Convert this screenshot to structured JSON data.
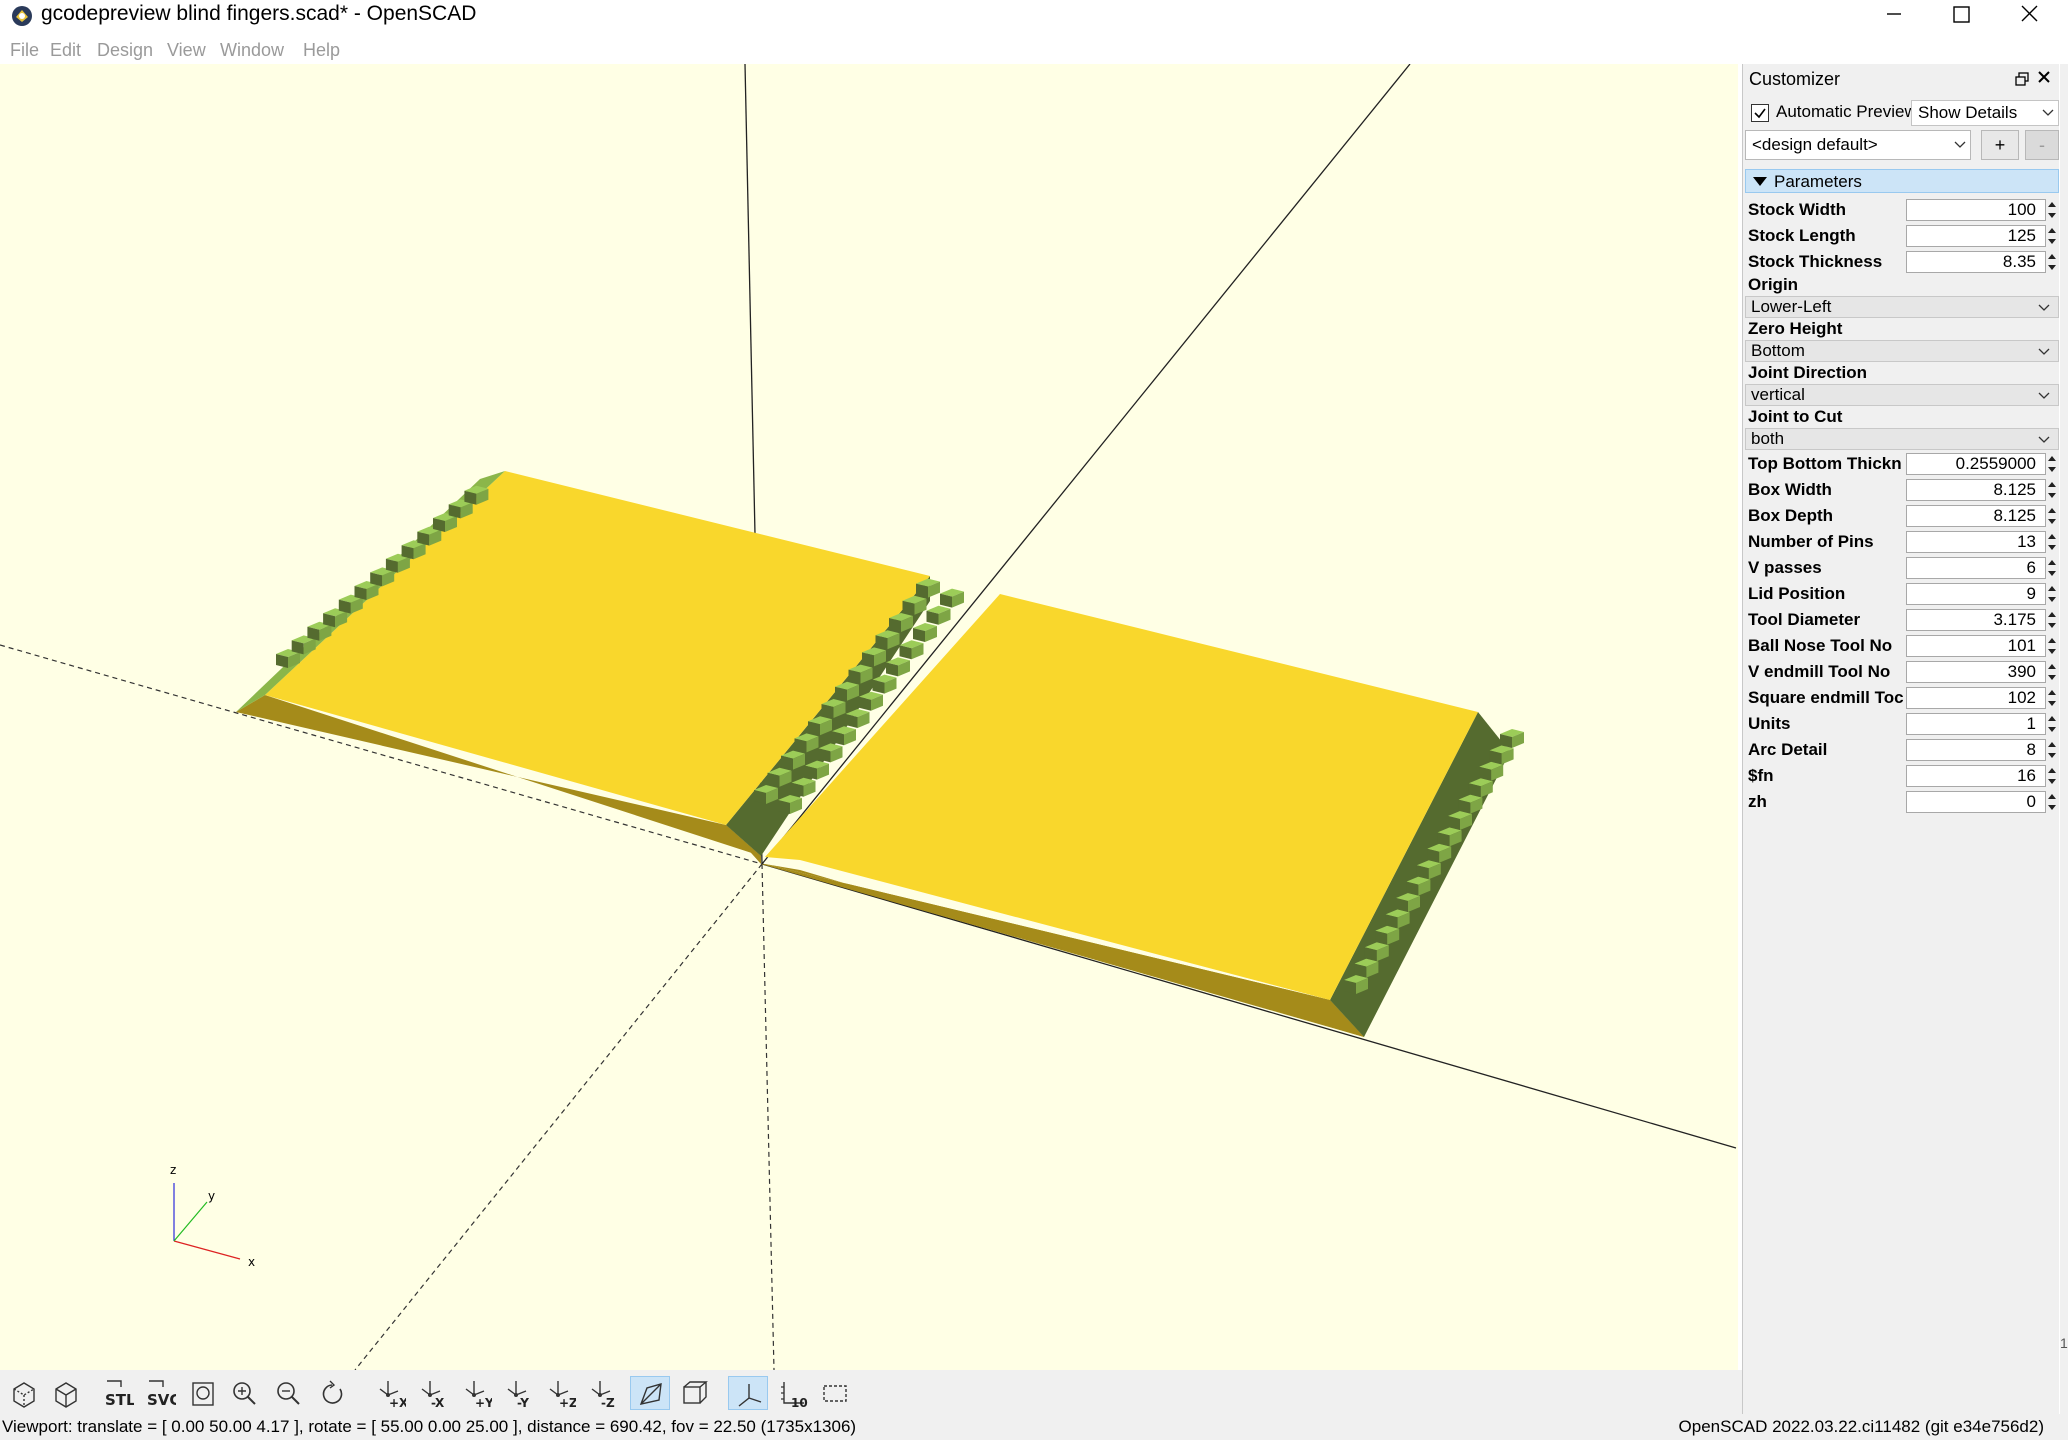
{
  "window": {
    "title": "gcodepreview blind fingers.scad* - OpenSCAD"
  },
  "menu": {
    "items": [
      "File",
      "Edit",
      "Design",
      "View",
      "Window",
      "Help"
    ]
  },
  "customizer": {
    "title": "Customizer",
    "auto_preview_label": "Automatic Preview",
    "auto_preview_checked": true,
    "show_details": "Show Details",
    "preset": "<design default>",
    "add_label": "+",
    "remove_label": "-",
    "section_label": "Parameters",
    "params": [
      {
        "label": "Stock Width",
        "value": "100"
      },
      {
        "label": "Stock Length",
        "value": "125"
      },
      {
        "label": "Stock Thickness",
        "value": "8.35"
      },
      {
        "label": "Origin",
        "select": "Lower-Left"
      },
      {
        "label": "Zero Height",
        "select": "Bottom"
      },
      {
        "label": "Joint Direction",
        "select": "vertical"
      },
      {
        "label": "Joint to Cut",
        "select": "both"
      },
      {
        "label": "Top Bottom Thickn",
        "value": "0.2559000"
      },
      {
        "label": "Box Width",
        "value": "8.125"
      },
      {
        "label": "Box Depth",
        "value": "8.125"
      },
      {
        "label": "Number of Pins",
        "value": "13"
      },
      {
        "label": "V passes",
        "value": "6"
      },
      {
        "label": "Lid Position",
        "value": "9"
      },
      {
        "label": "Tool Diameter",
        "value": "3.175"
      },
      {
        "label": "Ball Nose Tool No",
        "value": "101"
      },
      {
        "label": "V endmill Tool No",
        "value": "390"
      },
      {
        "label": "Square endmill Toc",
        "value": "102"
      },
      {
        "label": "Units",
        "value": "1"
      },
      {
        "label": "Arc Detail",
        "value": "8"
      },
      {
        "label": "$fn",
        "value": "16"
      },
      {
        "label": "zh",
        "value": "0"
      }
    ]
  },
  "axes_indicator": {
    "x": "x",
    "y": "y",
    "z": "z"
  },
  "toolbar": {
    "buttons": [
      {
        "name": "preview-button",
        "icon": "preview-icon"
      },
      {
        "name": "render-button",
        "icon": "render-icon"
      },
      {
        "name": "export-stl-button",
        "icon": "stl-icon",
        "text": "STL"
      },
      {
        "name": "export-svg-button",
        "icon": "svg-icon",
        "text": "SVG"
      },
      {
        "name": "view-all-button",
        "icon": "view-all-icon"
      },
      {
        "name": "zoom-in-button",
        "icon": "zoom-in-icon"
      },
      {
        "name": "zoom-out-button",
        "icon": "zoom-out-icon"
      },
      {
        "name": "reset-view-button",
        "icon": "reset-view-icon"
      },
      {
        "name": "view-right-button",
        "icon": "view-right-icon",
        "text": "+X"
      },
      {
        "name": "view-left-button",
        "icon": "view-left-icon",
        "text": "-X"
      },
      {
        "name": "view-back-button",
        "icon": "view-back-icon",
        "text": "+Y"
      },
      {
        "name": "view-front-button",
        "icon": "view-front-icon",
        "text": "-Y"
      },
      {
        "name": "view-top-button",
        "icon": "view-top-icon",
        "text": "+Z"
      },
      {
        "name": "view-bottom-button",
        "icon": "view-bottom-icon",
        "text": "-Z"
      },
      {
        "name": "perspective-button",
        "icon": "perspective-icon",
        "active": true
      },
      {
        "name": "orthogonal-button",
        "icon": "orthogonal-icon"
      },
      {
        "name": "show-axes-button",
        "icon": "axes-icon",
        "active": true
      },
      {
        "name": "show-scale-button",
        "icon": "scale-markers-icon",
        "text": "10"
      },
      {
        "name": "show-edges-button",
        "icon": "edges-icon"
      }
    ]
  },
  "status": {
    "viewport": "Viewport: translate = [ 0.00 50.00 4.17 ], rotate = [ 55.00 0.00 25.00 ], distance = 690.42, fov = 22.50 (1735x1306)",
    "version": "OpenSCAD 2022.03.22.ci11482 (git e34e756d2)",
    "corner": "1"
  },
  "colors": {
    "viewport_bg": "#ffffe5",
    "part_top": "#f9d72c",
    "part_side": "#a58b1a",
    "finger_top": "#9ccc58",
    "finger_side": "#556b2f",
    "accent": "#cce4f7"
  }
}
